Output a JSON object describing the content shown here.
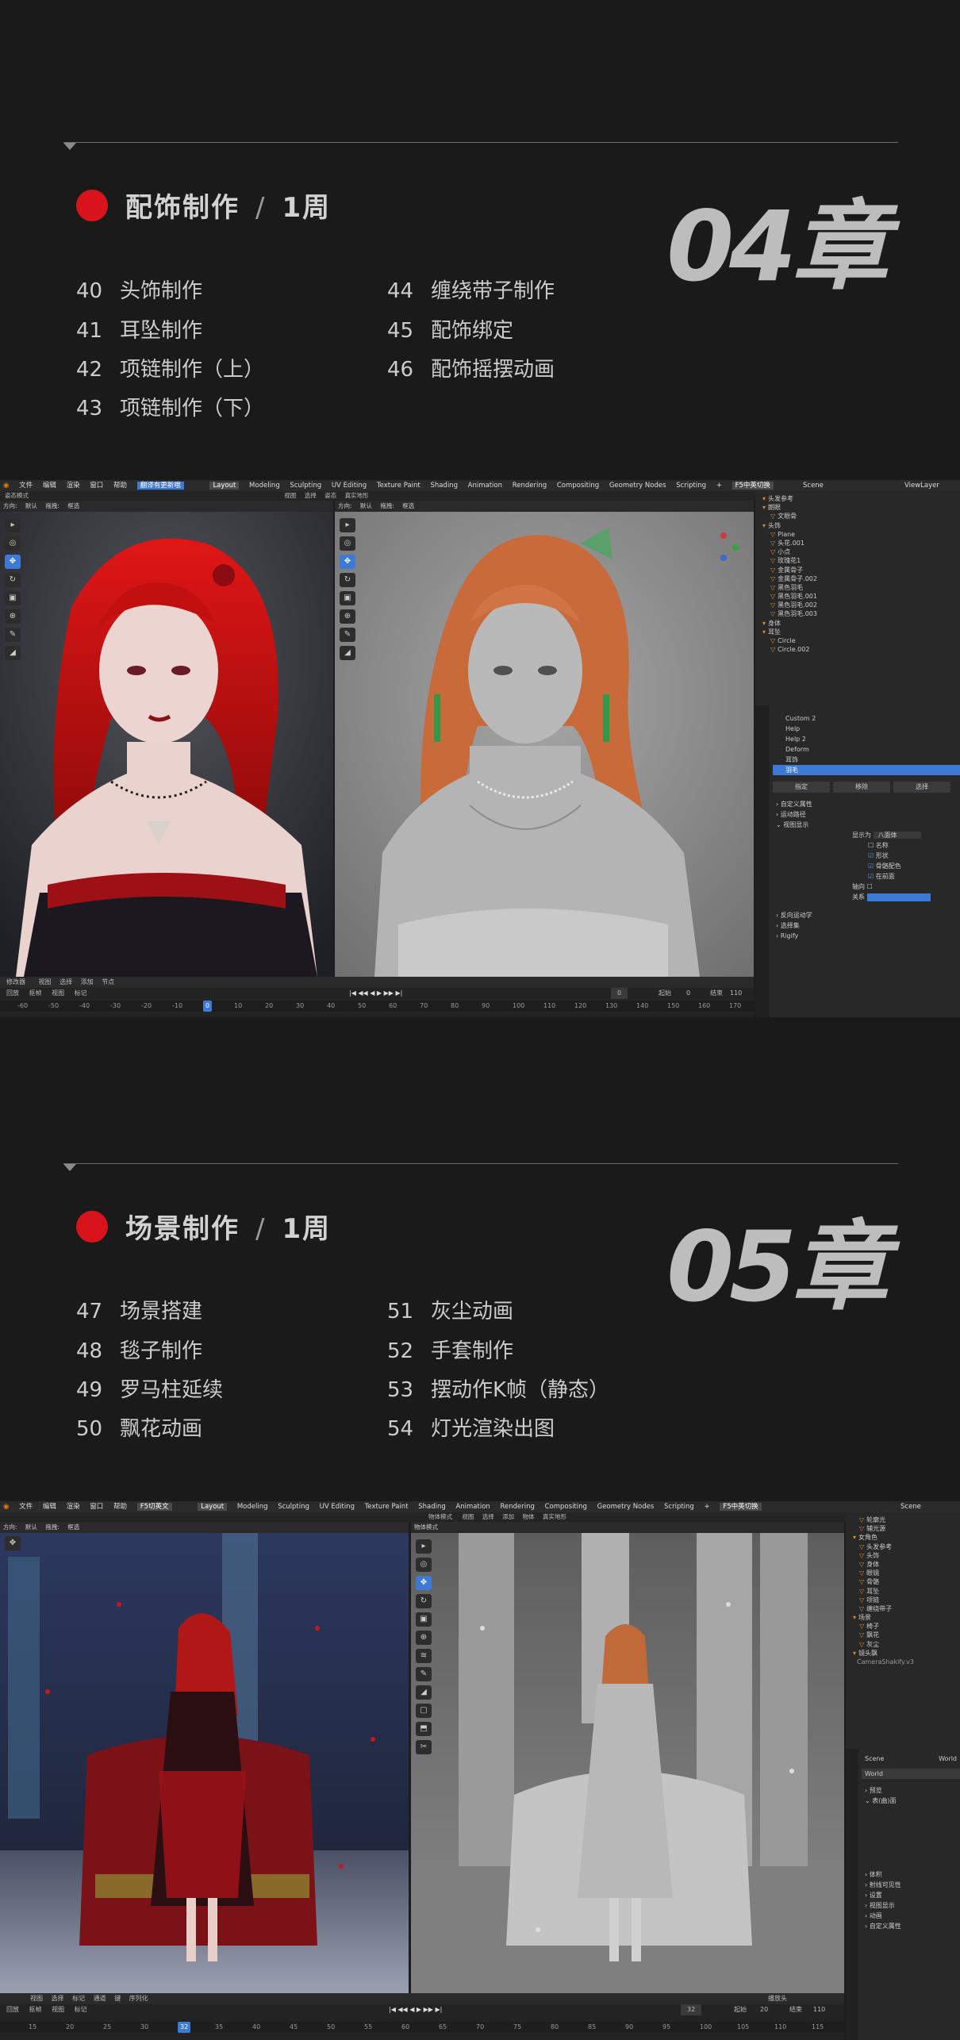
{
  "chapter4": {
    "title": "配饰制作",
    "duration": "1周",
    "chapter_label": "04章",
    "lessons": [
      {
        "num": "40",
        "name": "头饰制作"
      },
      {
        "num": "41",
        "name": "耳坠制作"
      },
      {
        "num": "42",
        "name": "项链制作（上）"
      },
      {
        "num": "43",
        "name": "项链制作（下）"
      },
      {
        "num": "44",
        "name": "缠绕带子制作"
      },
      {
        "num": "45",
        "name": "配饰绑定"
      },
      {
        "num": "46",
        "name": "配饰摇摆动画"
      }
    ]
  },
  "chapter5": {
    "title": "场景制作",
    "duration": "1周",
    "chapter_label": "05章",
    "lessons": [
      {
        "num": "47",
        "name": "场景搭建"
      },
      {
        "num": "48",
        "name": "毯子制作"
      },
      {
        "num": "49",
        "name": "罗马柱延续"
      },
      {
        "num": "50",
        "name": "飘花动画"
      },
      {
        "num": "51",
        "name": "灰尘动画"
      },
      {
        "num": "52",
        "name": "手套制作"
      },
      {
        "num": "53",
        "name": "摆动作K帧（静态）"
      },
      {
        "num": "54",
        "name": "灯光渲染出图"
      }
    ]
  },
  "blender1": {
    "menus": [
      "文件",
      "编辑",
      "渲染",
      "窗口",
      "帮助"
    ],
    "highlight_menu": "翻译有更新哦",
    "workspaces": [
      "Layout",
      "Modeling",
      "Sculpting",
      "UV Editing",
      "Texture Paint",
      "Shading",
      "Animation",
      "Rendering",
      "Compositing",
      "Geometry Nodes",
      "Scripting"
    ],
    "active_workspace": "Layout",
    "addon_badge": "F5中英切换",
    "scene": "Scene",
    "view_layer": "ViewLayer",
    "left_vp_header": [
      "方向:",
      "默认",
      "拖拽:",
      "框选"
    ],
    "right_vp_header": [
      "方向:",
      "默认",
      "拖拽:",
      "框选"
    ],
    "mode": "姿态模式",
    "view_menus": [
      "视图",
      "选择",
      "姿态",
      "真实地形"
    ],
    "outliner": [
      "头发参考",
      "朗眼",
      "文眼骨",
      "头饰",
      "Plane",
      "头花.001",
      "小点",
      "玫瑰花1",
      "金属骨子",
      "金属骨子.002",
      "黑色羽毛",
      "黑色羽毛.001",
      "黑色羽毛.002",
      "黑色羽毛.003",
      "身体",
      "耳坠",
      "Circle",
      "Circle.002"
    ],
    "props": [
      "Custom 2",
      "Help",
      "Help 2",
      "Deform",
      "耳饰",
      "羽毛"
    ],
    "props_buttons": [
      "指定",
      "移除",
      "选择"
    ],
    "props_sections": [
      "自定义属性",
      "运动路径",
      "视图显示"
    ],
    "display_as": "显示为",
    "display_as_value": "八面体",
    "display_options": [
      "名称",
      "形状",
      "骨骼配色",
      "在前面"
    ],
    "axes_label": "轴向",
    "relation": "关系",
    "bottom_sections": [
      "反向运动学",
      "选择集",
      "Rigify"
    ],
    "timeline_menus": [
      "回放",
      "抠帧",
      "视图",
      "标记"
    ],
    "frame_current": "0",
    "start_label": "起始",
    "start": "0",
    "end_label": "结束",
    "end": "110",
    "ruler": [
      "-60",
      "-50",
      "-40",
      "-30",
      "-20",
      "-10",
      "0",
      "10",
      "20",
      "30",
      "40",
      "50",
      "60",
      "70",
      "80",
      "90",
      "100",
      "110",
      "120",
      "130",
      "140",
      "150",
      "160",
      "170"
    ],
    "editor_row": [
      "修改器",
      "视图",
      "选择",
      "添加",
      "节点"
    ]
  },
  "blender2": {
    "menus": [
      "文件",
      "编辑",
      "渲染",
      "窗口",
      "帮助"
    ],
    "addon_badge": "F5切英文",
    "workspaces": [
      "Layout",
      "Modeling",
      "Sculpting",
      "UV Editing",
      "Texture Paint",
      "Shading",
      "Animation",
      "Rendering",
      "Compositing",
      "Geometry Nodes",
      "Scripting"
    ],
    "active_workspace": "Layout",
    "addon_badge2": "F5中英切换",
    "scene": "Scene",
    "left_vp_header": [
      "方向:",
      "默认",
      "拖拽:",
      "框选"
    ],
    "right_mode": "物体模式",
    "right_vp_menus": [
      "视图",
      "选择",
      "添加",
      "物体",
      "真实地形"
    ],
    "outliner": [
      "轮廓光",
      "辅光源",
      "女角色",
      "头发参考",
      "头饰",
      "身体",
      "眼镜",
      "骨骼",
      "耳坠",
      "项链",
      "缠绕带子",
      "场景",
      "椅子",
      "飘花",
      "灰尘",
      "镜头飘",
      "CameraShakify.v3"
    ],
    "props_scene": "Scene",
    "props_world_label": "World",
    "props_world": "World",
    "props_sections": [
      "预览",
      "表(曲)面",
      "体积",
      "射线可见性",
      "设置",
      "视图显示",
      "动画",
      "自定义属性"
    ],
    "timeline_menus": [
      "回放",
      "抠帧",
      "视图",
      "标记"
    ],
    "frame_current": "32",
    "start_label": "起始",
    "start": "20",
    "end_label": "结束",
    "end": "110",
    "editor_row": [
      "视图",
      "选择",
      "标记",
      "通道",
      "键",
      "序列化"
    ],
    "ruler": [
      "15",
      "20",
      "25",
      "30",
      "32",
      "35",
      "40",
      "45",
      "50",
      "55",
      "60",
      "65",
      "70",
      "75",
      "80",
      "85",
      "90",
      "95",
      "100",
      "105",
      "110",
      "115"
    ],
    "playback_label": "播放头"
  }
}
